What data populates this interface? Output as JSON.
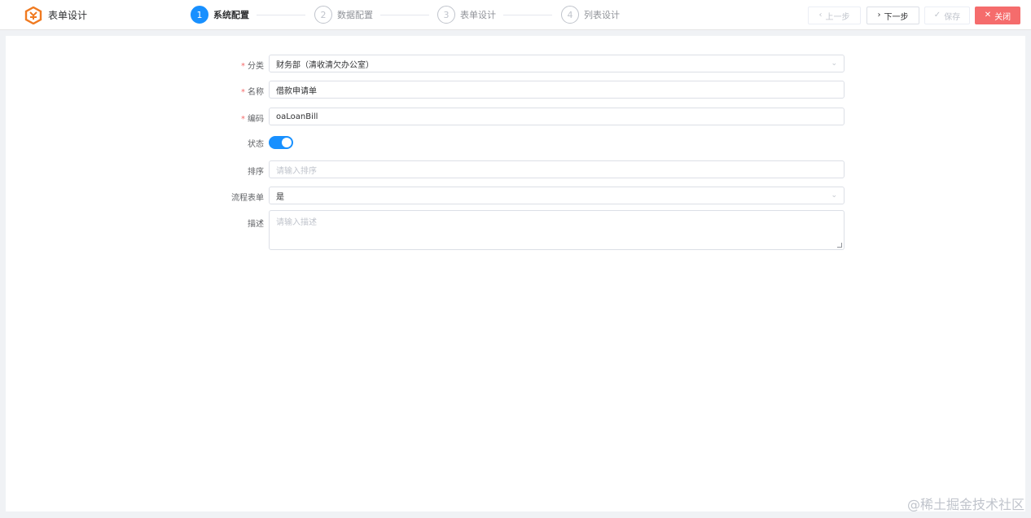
{
  "header": {
    "title": "表单设计",
    "steps": [
      {
        "num": "1",
        "label": "系统配置",
        "active": true
      },
      {
        "num": "2",
        "label": "数据配置",
        "active": false
      },
      {
        "num": "3",
        "label": "表单设计",
        "active": false
      },
      {
        "num": "4",
        "label": "列表设计",
        "active": false
      }
    ],
    "buttons": {
      "prev": "上一步",
      "next": "下一步",
      "save": "保存",
      "close": "关闭"
    }
  },
  "form": {
    "category": {
      "label": "分类",
      "value": "财务部（清收清欠办公室）",
      "required": true
    },
    "name": {
      "label": "名称",
      "value": "借款申请单",
      "required": true
    },
    "code": {
      "label": "编码",
      "value": "oaLoanBill",
      "required": true
    },
    "status": {
      "label": "状态",
      "enabled": true
    },
    "sort": {
      "label": "排序",
      "placeholder": "请输入排序"
    },
    "process_form": {
      "label": "流程表单",
      "value": "是"
    },
    "description": {
      "label": "描述",
      "placeholder": "请输入描述"
    }
  },
  "watermark": "@稀土掘金技术社区",
  "colors": {
    "primary": "#1890ff",
    "danger": "#f56c6c",
    "required": "#f56c6c"
  }
}
